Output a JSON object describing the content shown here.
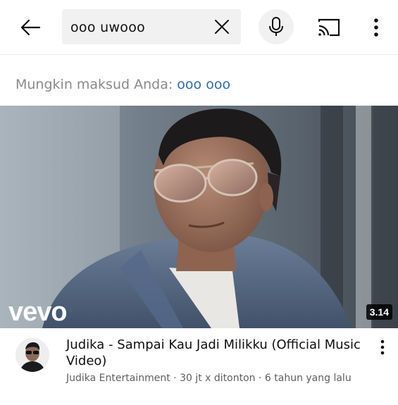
{
  "search": {
    "query": "ooo uwooo"
  },
  "suggestion": {
    "prefix": "Mungkin maksud Anda:",
    "correction": "ooo ooo"
  },
  "video": {
    "watermark": "vevo",
    "duration": "3.14",
    "title": "Judika - Sampai Kau Jadi Milikku (Official Music Video)",
    "channel": "Judika Entertainment",
    "separator": "·",
    "views": "30 jt x ditonton",
    "age": "6 tahun yang lalu"
  },
  "icons": {
    "back": "arrow-left-icon",
    "clear": "close-icon",
    "mic": "microphone-icon",
    "cast": "cast-icon",
    "more": "more-vertical-icon"
  },
  "colors": {
    "link": "#2a6cb8",
    "muted": "#8a8a8a",
    "meta": "#606060",
    "search_bg": "#f1f1f1"
  }
}
